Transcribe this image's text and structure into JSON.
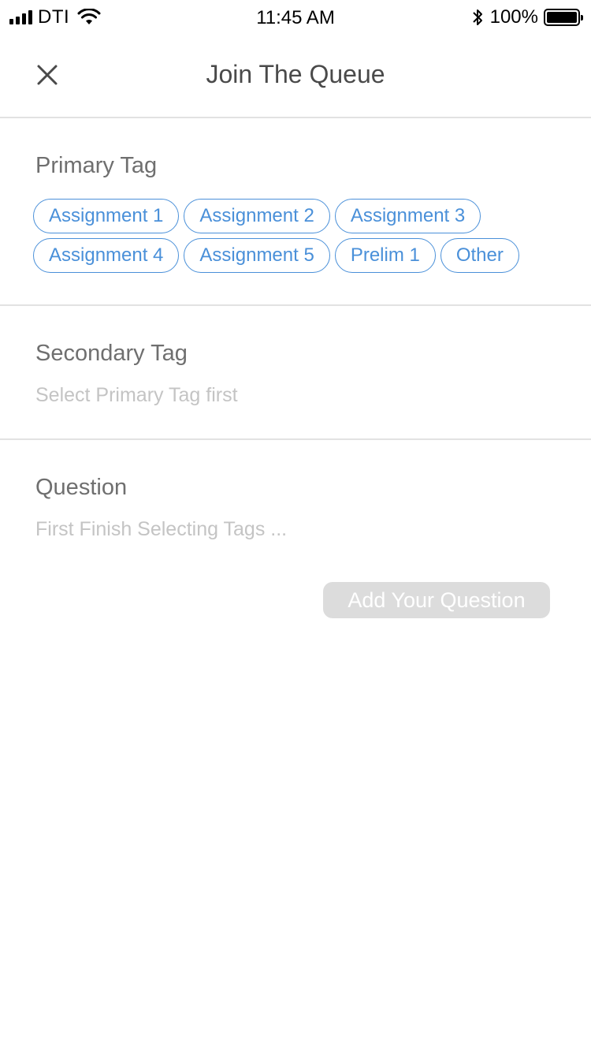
{
  "status_bar": {
    "carrier": "DTI",
    "time": "11:45 AM",
    "battery_percent": "100%",
    "signal_icon": "signal-bars-icon",
    "wifi_icon": "wifi-icon",
    "bluetooth_icon": "bluetooth-icon",
    "battery_level": 1.0
  },
  "header": {
    "title": "Join The Queue",
    "close_icon": "close-icon"
  },
  "primary_tag": {
    "title": "Primary Tag",
    "tags": [
      "Assignment 1",
      "Assignment 2",
      "Assignment 3",
      "Assignment 4",
      "Assignment 5",
      "Prelim 1",
      "Other"
    ]
  },
  "secondary_tag": {
    "title": "Secondary Tag",
    "hint": "Select Primary Tag first"
  },
  "question": {
    "title": "Question",
    "placeholder": "First Finish Selecting Tags ...",
    "submit_label": "Add Your Question"
  },
  "colors": {
    "accent": "#4a90d9",
    "divider": "#e2e2e2",
    "disabled_button": "#dcdcdc",
    "hint_text": "#c4c4c4"
  }
}
